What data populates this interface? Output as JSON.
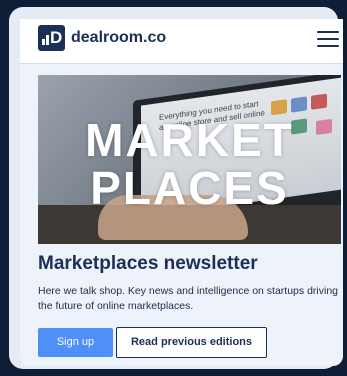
{
  "navbar": {
    "brand": "dealroom.co",
    "logo_letter": "D"
  },
  "hero": {
    "title_line1": "MARKET",
    "title_line2": "PLACES",
    "screen_text": "Everything you need to start an online store and sell online"
  },
  "content": {
    "headline": "Marketplaces newsletter",
    "description": "Here we talk shop. Key news and intelligence on startups driving the future of online marketplaces.",
    "signup_label": "Sign up",
    "previous_label": "Read previous editions"
  },
  "colors": {
    "brand_navy": "#1b2f57",
    "primary_blue": "#4f8ff7",
    "page_bg": "#0f1e36"
  }
}
